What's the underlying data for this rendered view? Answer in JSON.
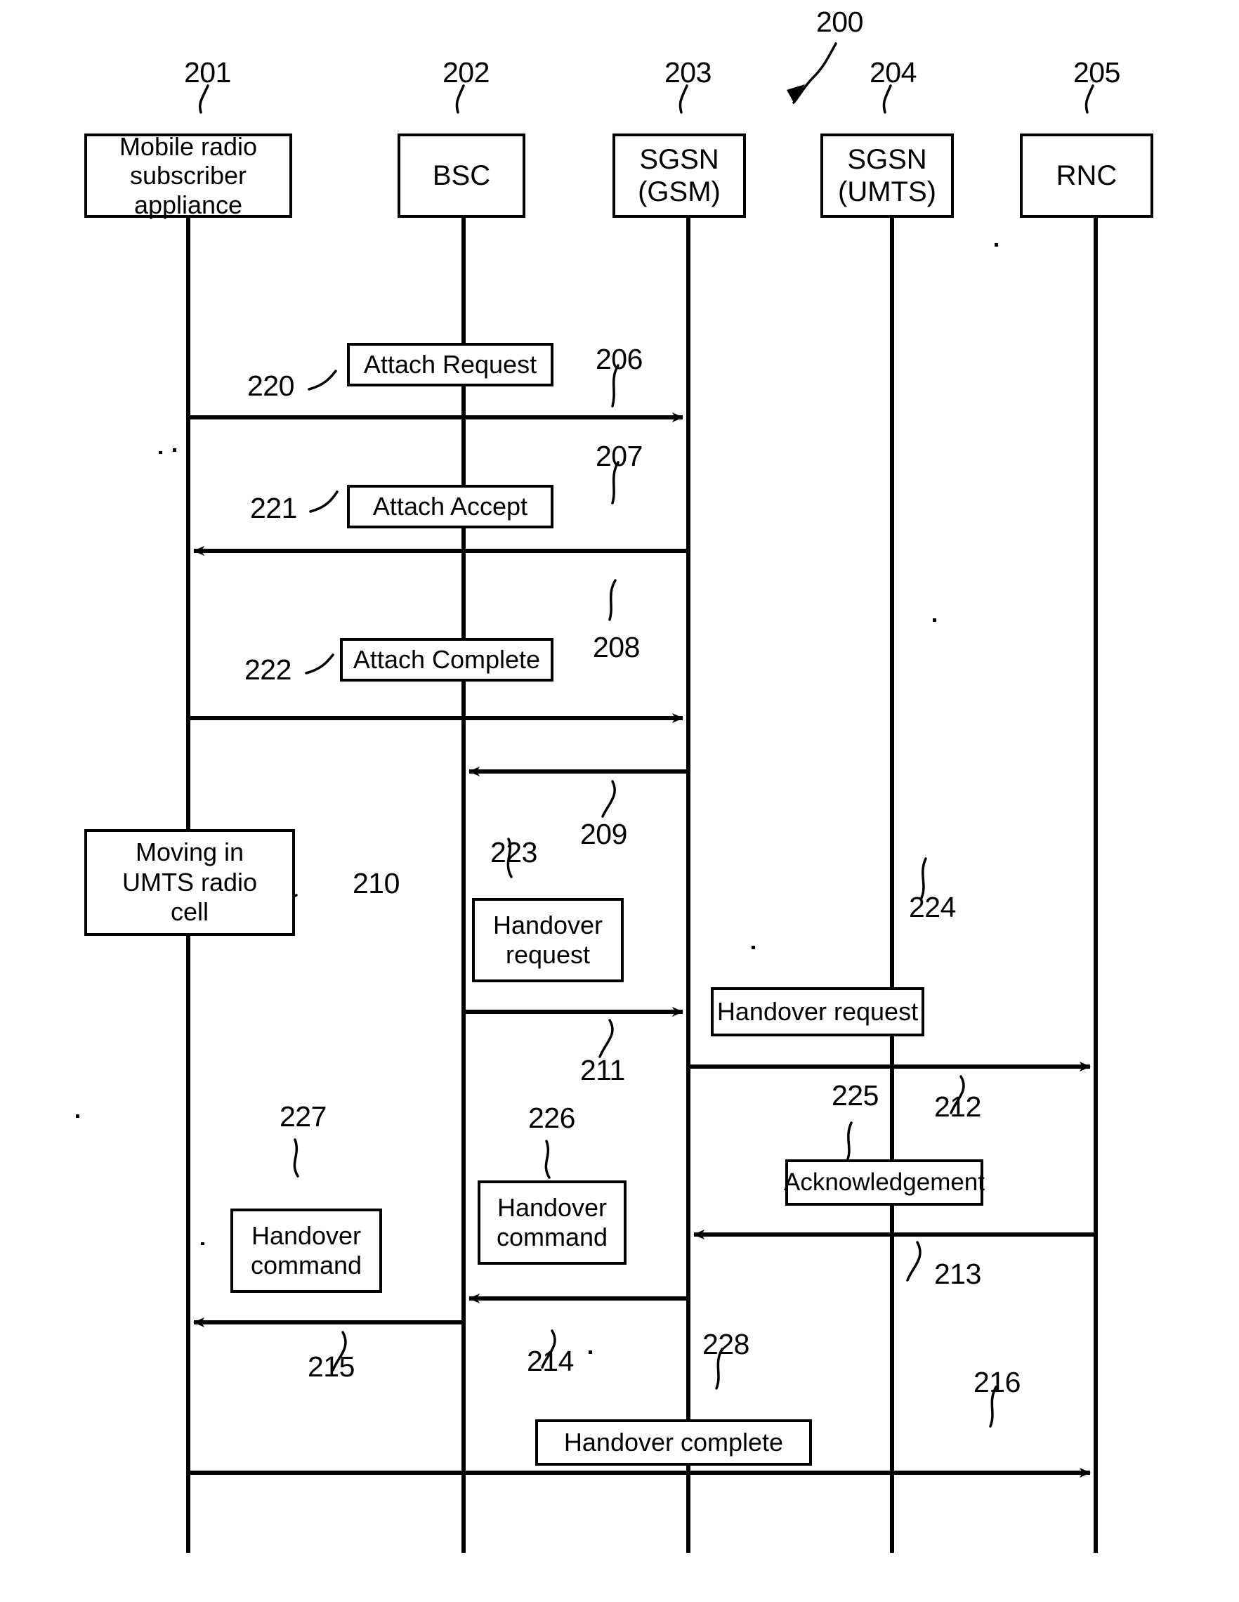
{
  "figure": {
    "ref_label": "200",
    "type": "patent-sequence-diagram"
  },
  "nodes": [
    {
      "id": "n201",
      "ref": "201",
      "label": "Mobile radio\nsubscriber appliance"
    },
    {
      "id": "n202",
      "ref": "202",
      "label": "BSC"
    },
    {
      "id": "n203",
      "ref": "203",
      "label": "SGSN\n(GSM)"
    },
    {
      "id": "n204",
      "ref": "204",
      "label": "SGSN\n(UMTS)"
    },
    {
      "id": "n205",
      "ref": "205",
      "label": "RNC"
    }
  ],
  "messages": [
    {
      "ref": "220",
      "label": "Attach Request",
      "arrow_ref": "206",
      "from": "201",
      "to": "203",
      "direction": "right"
    },
    {
      "ref": "221",
      "label": "Attach Accept",
      "arrow_ref": "207",
      "from": "203",
      "to": "201",
      "direction": "left"
    },
    {
      "ref": "222",
      "label": "Attach Complete",
      "arrow_ref": "208",
      "from": "201",
      "to": "203",
      "direction": "right"
    },
    {
      "ref": null,
      "label": null,
      "arrow_ref": "209",
      "from": "203",
      "to": "202",
      "direction": "left"
    },
    {
      "ref": "223",
      "label": "Handover\nrequest",
      "arrow_ref": "211",
      "from": "202",
      "to": "203",
      "direction": "right"
    },
    {
      "ref": "224",
      "label": "Handover  request",
      "arrow_ref": "212",
      "from": "203",
      "to": "205",
      "direction": "right"
    },
    {
      "ref": "225",
      "label": "Acknowledgement",
      "arrow_ref": "213",
      "from": "205",
      "to": "203",
      "direction": "left"
    },
    {
      "ref": "226",
      "label": "Handover\ncommand",
      "arrow_ref": "214",
      "from": "203",
      "to": "202",
      "direction": "left"
    },
    {
      "ref": "227",
      "label": "Handover\ncommand",
      "arrow_ref": "215",
      "from": "202",
      "to": "201",
      "direction": "left"
    },
    {
      "ref": "228",
      "label": "Handover complete",
      "arrow_ref": "216",
      "from": "201",
      "to": "205",
      "direction": "right"
    }
  ],
  "state_boxes": [
    {
      "ref": "210",
      "label": "Moving in\nUMTS radio\ncell",
      "on": "201"
    }
  ],
  "labels": {
    "n201_text_line1": "Mobile radio",
    "n201_text_line2": "subscriber appliance",
    "n202_text": "BSC",
    "n203_text_line1": "SGSN",
    "n203_text_line2": "(GSM)",
    "n204_text_line1": "SGSN",
    "n204_text_line2": "(UMTS)",
    "n205_text": "RNC",
    "msg_attach_request": "Attach Request",
    "msg_attach_accept": "Attach Accept",
    "msg_attach_complete": "Attach Complete",
    "msg_handover_request_bsc_l1": "Handover",
    "msg_handover_request_bsc_l2": "request",
    "msg_handover_request_sgsn": "Handover  request",
    "msg_acknowledgement": "Acknowledgement",
    "msg_handover_command_sgsn_l1": "Handover",
    "msg_handover_command_sgsn_l2": "command",
    "msg_handover_command_bsc_l1": "Handover",
    "msg_handover_command_bsc_l2": "command",
    "msg_handover_complete": "Handover complete",
    "state_moving_l1": "Moving in",
    "state_moving_l2": "UMTS radio",
    "state_moving_l3": "cell"
  },
  "refs": {
    "fig": "200",
    "r201": "201",
    "r202": "202",
    "r203": "203",
    "r204": "204",
    "r205": "205",
    "r206": "206",
    "r207": "207",
    "r208": "208",
    "r209": "209",
    "r210": "210",
    "r211": "211",
    "r212": "212",
    "r213": "213",
    "r214": "214",
    "r215": "215",
    "r216": "216",
    "r220": "220",
    "r221": "221",
    "r222": "222",
    "r223": "223",
    "r224": "224",
    "r225": "225",
    "r226": "226",
    "r227": "227",
    "r228": "228"
  },
  "colors": {
    "ink": "#000000",
    "paper": "#ffffff"
  }
}
